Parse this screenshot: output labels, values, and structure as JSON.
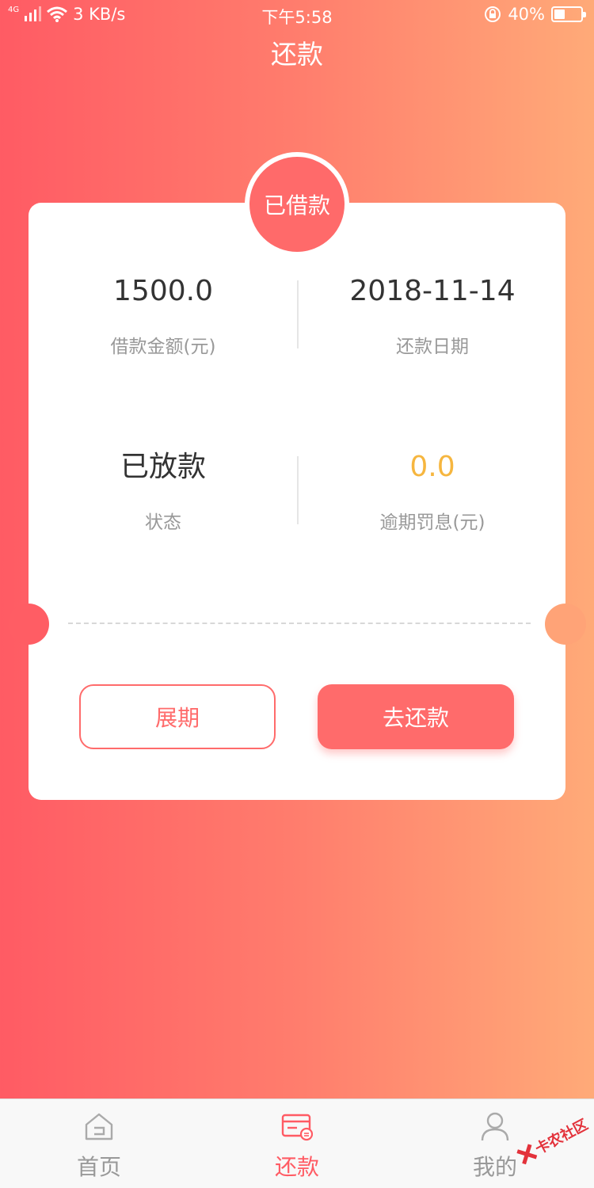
{
  "status_bar": {
    "network_tag": "4G",
    "speed": "3 KB/s",
    "time": "下午5:58",
    "battery": "40%",
    "battery_level": 0.4
  },
  "header": {
    "title": "还款"
  },
  "card": {
    "badge": "已借款",
    "loan_amount": {
      "value": "1500.0",
      "label": "借款金额(元)"
    },
    "repay_date": {
      "value": "2018-11-14",
      "label": "还款日期"
    },
    "status": {
      "value": "已放款",
      "label": "状态"
    },
    "penalty": {
      "value": "0.0",
      "label": "逾期罚息(元)",
      "color": "#f6b63f"
    },
    "extend_button": "展期",
    "repay_button": "去还款"
  },
  "tab_bar": {
    "items": [
      {
        "label": "首页",
        "icon": "home-icon",
        "active": false
      },
      {
        "label": "还款",
        "icon": "repay-card-icon",
        "active": true
      },
      {
        "label": "我的",
        "icon": "user-icon",
        "active": false
      }
    ]
  },
  "watermark": {
    "text": "卡农社区"
  },
  "colors": {
    "accent": "#ff6b6b",
    "gradient_start": "#ff5b64",
    "gradient_end": "#ffaa78"
  }
}
